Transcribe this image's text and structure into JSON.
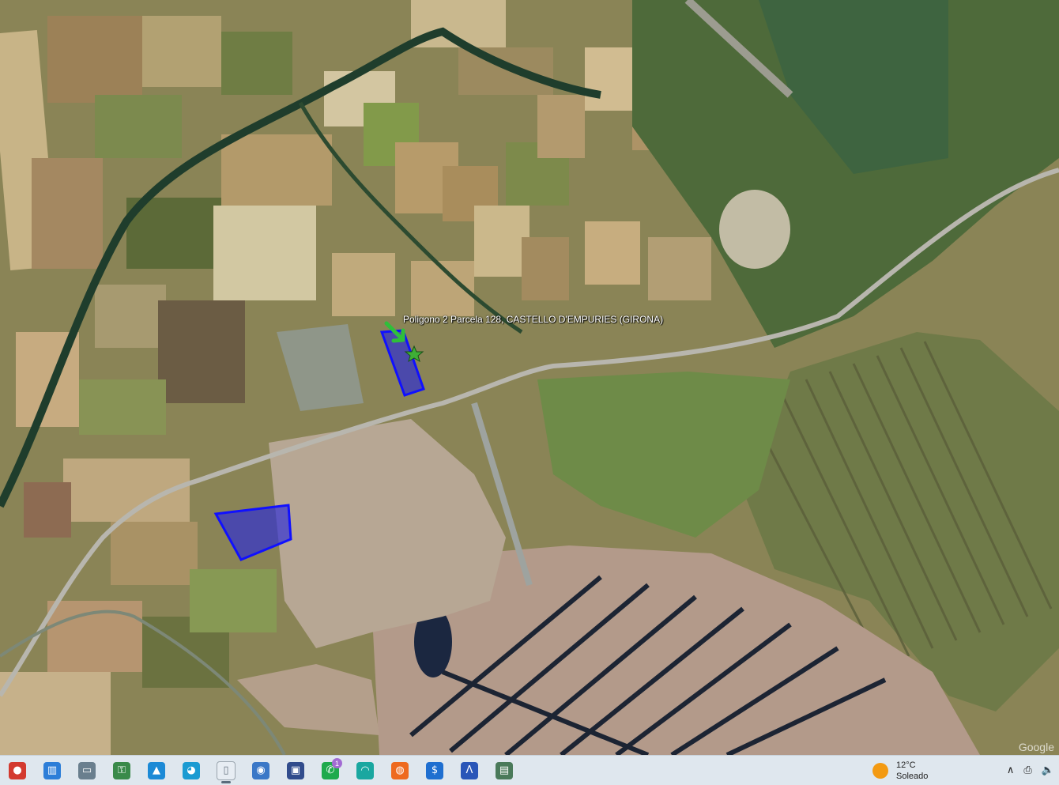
{
  "map": {
    "parcel_label": "Poligono 2 Parcela 128, CASTELLO D'EMPURIES (GIRONA)",
    "watermark": "Google",
    "parcel_color": "#1e1ef0"
  },
  "taskbar": {
    "icons": [
      {
        "name": "chrome-icon",
        "glyph": "●",
        "color": "#d33a2f"
      },
      {
        "name": "photos-icon",
        "glyph": "▥",
        "color": "#2d7ed8"
      },
      {
        "name": "file-explorer-icon",
        "glyph": "▭",
        "color": "#6a7f8e"
      },
      {
        "name": "security-app-icon",
        "glyph": "⚿",
        "color": "#3a8a4a"
      },
      {
        "name": "gallery-icon",
        "glyph": "▲",
        "color": "#1c8ad6"
      },
      {
        "name": "edge-icon",
        "glyph": "◕",
        "color": "#1b9bd2"
      },
      {
        "name": "document-icon",
        "glyph": "▯",
        "color": "#e7edf3"
      },
      {
        "name": "google-earth-icon",
        "glyph": "◉",
        "color": "#3b78c7"
      },
      {
        "name": "save-disk-icon",
        "glyph": "▣",
        "color": "#314c8c"
      },
      {
        "name": "whatsapp-icon",
        "glyph": "✆",
        "color": "#1eaa4c"
      },
      {
        "name": "wave-app-icon",
        "glyph": "◠",
        "color": "#1aa7a0"
      },
      {
        "name": "firefox-icon",
        "glyph": "◍",
        "color": "#ee6a1f"
      },
      {
        "name": "dollar-app-icon",
        "glyph": "$",
        "color": "#1f6fd0"
      },
      {
        "name": "arc-app-icon",
        "glyph": "Λ",
        "color": "#2a56b8"
      },
      {
        "name": "window-app-icon",
        "glyph": "▤",
        "color": "#4a7a5a"
      }
    ],
    "whatsapp_badge": "1",
    "weather": {
      "temperature": "12°C",
      "condition": "Soleado"
    },
    "tray": {
      "chevron": "∧",
      "network": "⎙",
      "volume": "🔈"
    }
  }
}
